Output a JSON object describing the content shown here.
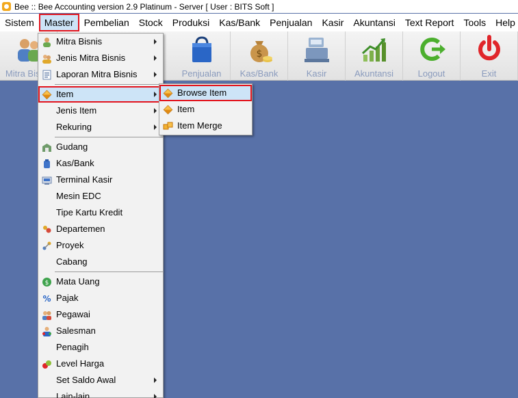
{
  "window": {
    "title": "Bee :: Bee Accounting version 2.9 Platinum - Server  [ User : BITS Soft ]"
  },
  "menubar": {
    "items": [
      {
        "label": "Sistem"
      },
      {
        "label": "Master"
      },
      {
        "label": "Pembelian"
      },
      {
        "label": "Stock"
      },
      {
        "label": "Produksi"
      },
      {
        "label": "Kas/Bank"
      },
      {
        "label": "Penjualan"
      },
      {
        "label": "Kasir"
      },
      {
        "label": "Akuntansi"
      },
      {
        "label": "Text Report"
      },
      {
        "label": "Tools"
      },
      {
        "label": "Help"
      }
    ]
  },
  "toolbar": {
    "items": [
      {
        "label": "Mitra Bisnis",
        "icon": "people-icon"
      },
      {
        "label": "Penjualan",
        "icon": "shopping-bag-icon"
      },
      {
        "label": "Kas/Bank",
        "icon": "money-bag-icon"
      },
      {
        "label": "Kasir",
        "icon": "cash-register-icon"
      },
      {
        "label": "Akuntansi",
        "icon": "growth-chart-icon"
      },
      {
        "label": "Logout",
        "icon": "logout-icon"
      },
      {
        "label": "Exit",
        "icon": "power-icon"
      }
    ]
  },
  "master_menu": {
    "items": [
      {
        "label": "Mitra Bisnis",
        "icon": "user-icon",
        "submenu": true
      },
      {
        "label": "Jenis Mitra Bisnis",
        "icon": "users-icon",
        "submenu": true
      },
      {
        "label": "Laporan Mitra Bisnis",
        "icon": "report-icon",
        "submenu": true
      },
      {
        "label": "Item",
        "icon": "item-cube-icon",
        "submenu": true
      },
      {
        "label": "Jenis Item",
        "icon": "",
        "submenu": true
      },
      {
        "label": "Rekuring",
        "icon": "",
        "submenu": true
      },
      {
        "label": "Gudang",
        "icon": "warehouse-icon",
        "submenu": false
      },
      {
        "label": "Kas/Bank",
        "icon": "bank-icon",
        "submenu": false
      },
      {
        "label": "Terminal Kasir",
        "icon": "terminal-icon",
        "submenu": false
      },
      {
        "label": "Mesin EDC",
        "icon": "",
        "submenu": false
      },
      {
        "label": "Tipe Kartu Kredit",
        "icon": "",
        "submenu": false
      },
      {
        "label": "Departemen",
        "icon": "department-icon",
        "submenu": false
      },
      {
        "label": "Proyek",
        "icon": "project-icon",
        "submenu": false
      },
      {
        "label": "Cabang",
        "icon": "",
        "submenu": false
      },
      {
        "label": "Mata Uang",
        "icon": "currency-icon",
        "submenu": false
      },
      {
        "label": "Pajak",
        "icon": "percent-icon",
        "submenu": false
      },
      {
        "label": "Pegawai",
        "icon": "employee-icon",
        "submenu": false
      },
      {
        "label": "Salesman",
        "icon": "salesman-icon",
        "submenu": false
      },
      {
        "label": "Penagih",
        "icon": "",
        "submenu": false
      },
      {
        "label": "Level Harga",
        "icon": "price-level-icon",
        "submenu": false
      },
      {
        "label": "Set Saldo Awal",
        "icon": "",
        "submenu": true
      },
      {
        "label": "Lain-lain",
        "icon": "",
        "submenu": true
      }
    ]
  },
  "item_submenu": {
    "items": [
      {
        "label": "Browse Item",
        "icon": "item-cube-icon"
      },
      {
        "label": "Item",
        "icon": "item-cube-icon"
      },
      {
        "label": "Item Merge",
        "icon": "item-merge-icon"
      }
    ]
  }
}
